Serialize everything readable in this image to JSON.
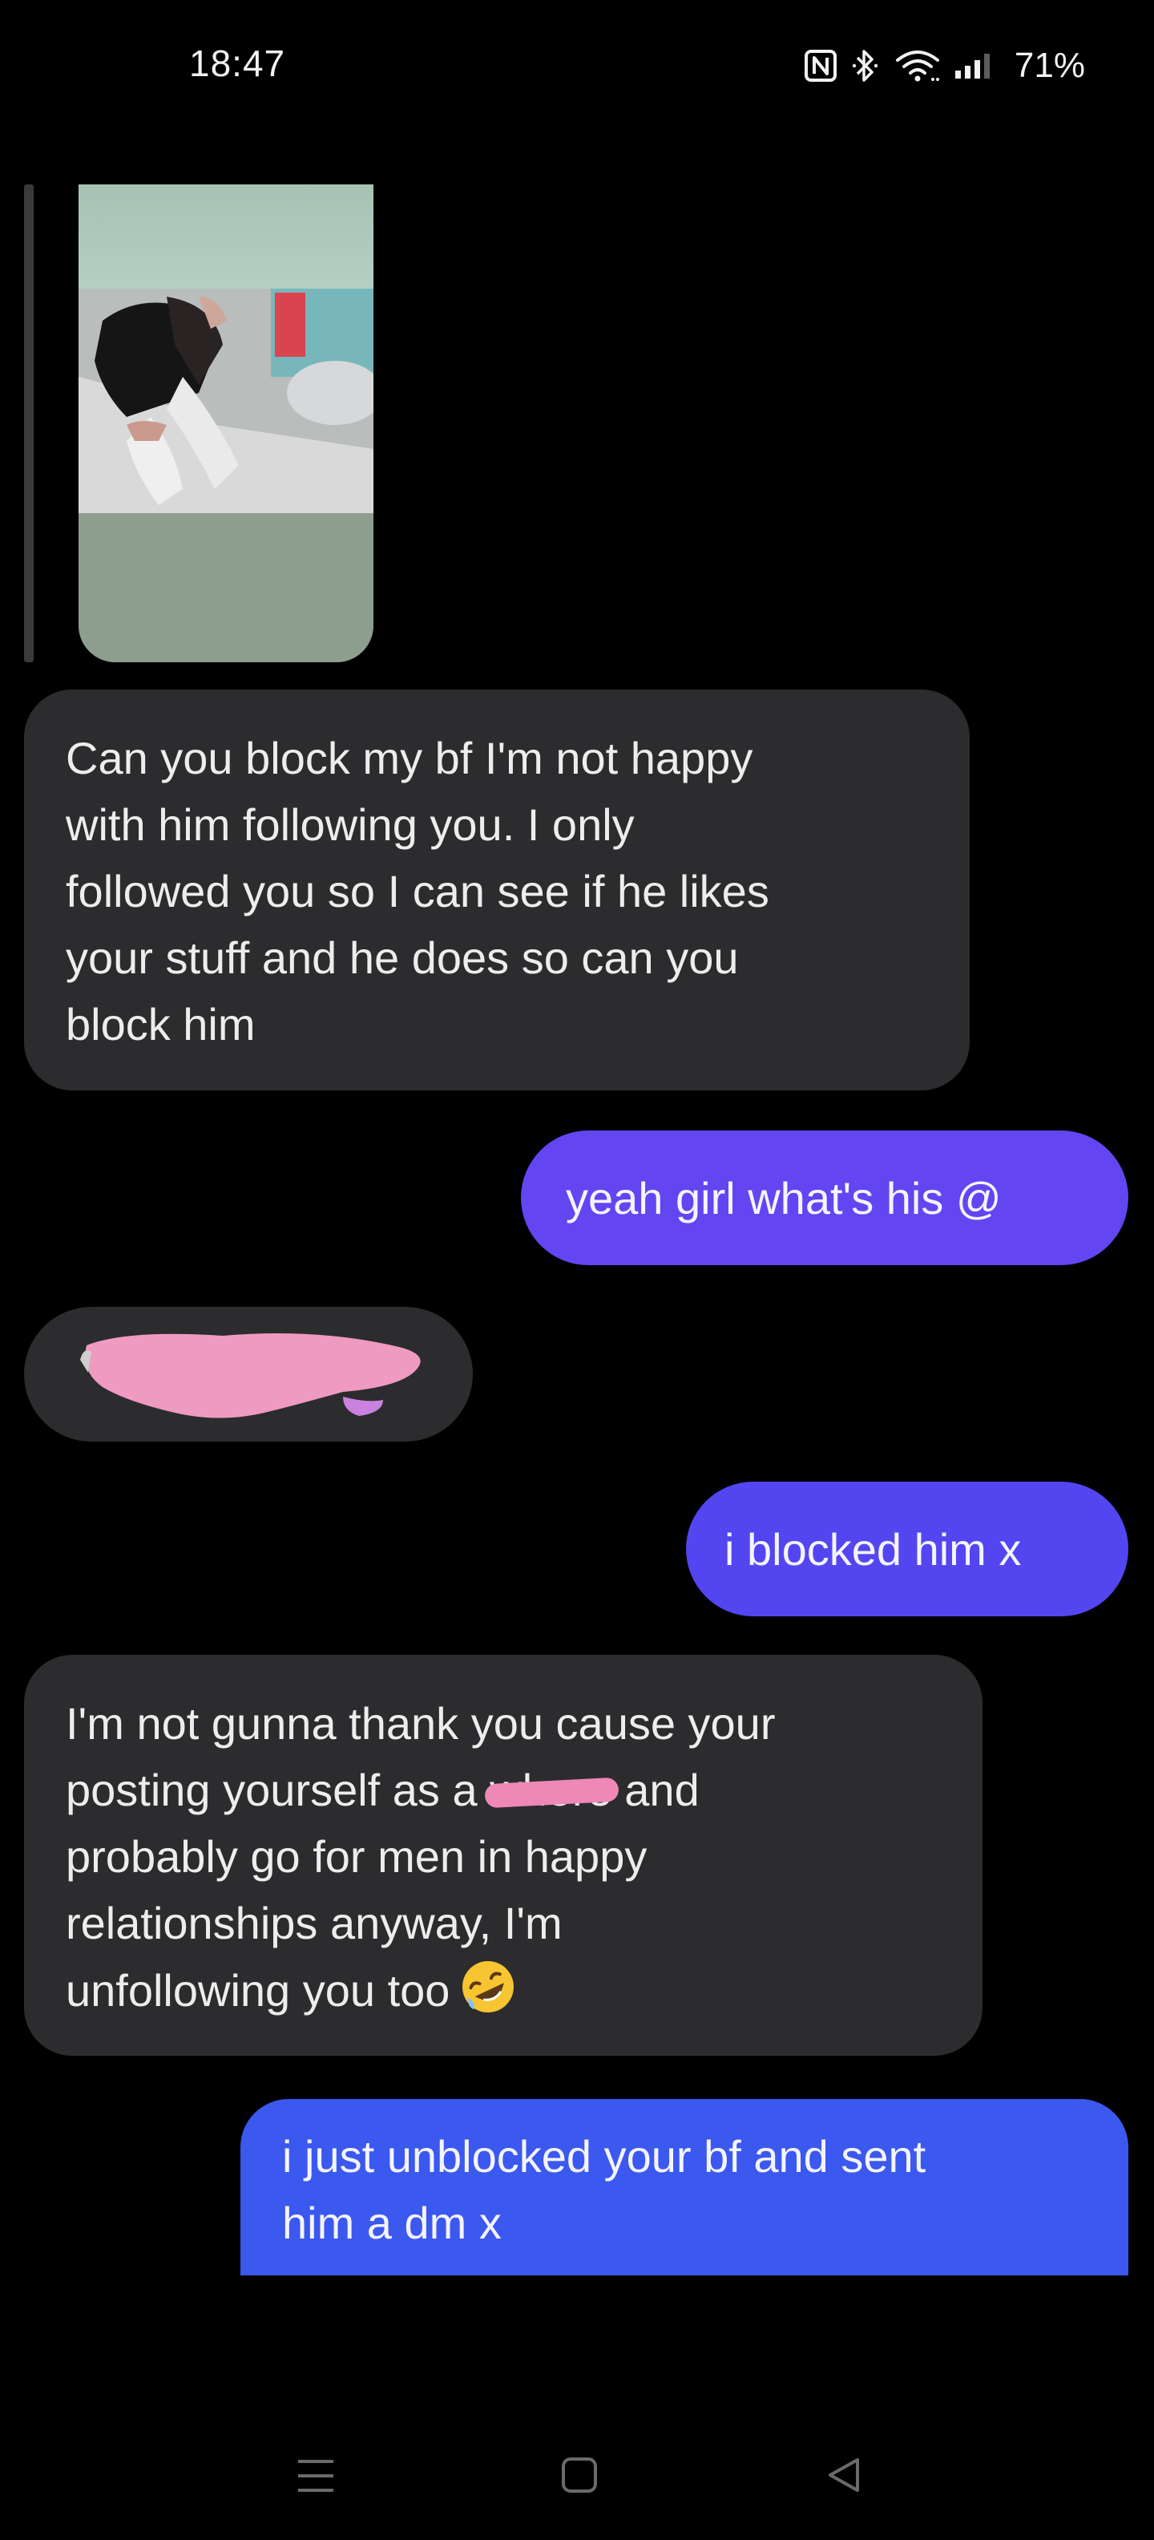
{
  "status_bar": {
    "time": "18:47",
    "battery": "71%",
    "icons": [
      "nfc-icon",
      "bluetooth-icon",
      "wifi-icon",
      "signal-icon"
    ]
  },
  "thread": {
    "media_preview": "photo-attachment",
    "messages": [
      {
        "side": "incoming",
        "lines": [
          "Can you block my bf I'm not happy",
          "with him following you. I only",
          "followed you so I can see if he likes",
          "your stuff and he does so can you",
          "block him"
        ]
      },
      {
        "side": "outgoing",
        "text": "yeah girl what's his @"
      },
      {
        "side": "incoming",
        "text": ""
      },
      {
        "side": "outgoing",
        "text": "i blocked him x"
      },
      {
        "side": "incoming",
        "lines": [
          "I'm not gunna thank you cause your",
          "posting yourself as a",
          "and",
          "probably go for men in happy",
          "relationships anyway, I'm",
          "unfollowing you too"
        ],
        "redacted_word": "whore"
      },
      {
        "side": "outgoing",
        "lines": [
          "i just unblocked your bf and sent",
          "him a dm x"
        ]
      }
    ]
  },
  "colors": {
    "incoming_bubble": "#2c2c2e",
    "outgoing_bubble_purple": "#6345f2",
    "outgoing_bubble_blue": "#3b58ef",
    "redaction": "#ef88b6"
  },
  "nav_bar": {
    "icons": [
      "menu-icon",
      "home-icon",
      "back-icon"
    ]
  }
}
